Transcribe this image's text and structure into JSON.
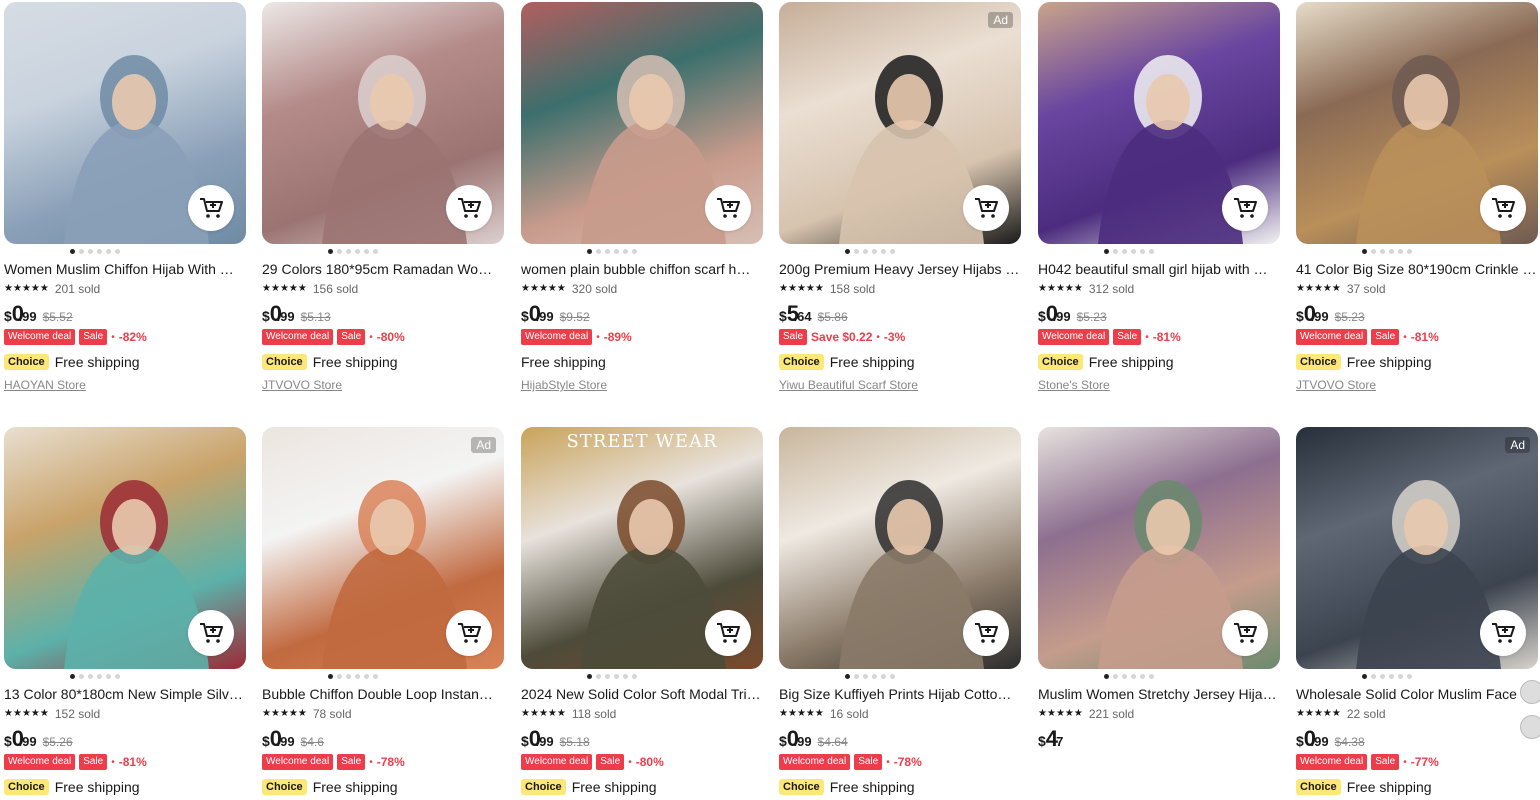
{
  "cards": [
    {
      "title": "Women Muslim Chiffon Hijab With …",
      "sold": "201 sold",
      "currency": "$",
      "price_int": "0",
      "price_dec": ".99",
      "old": "$5.52",
      "tags": [
        "Welcome deal",
        "Sale"
      ],
      "disc": "-82%",
      "choice": "Choice",
      "shipping": "Free shipping",
      "store": "HAOYAN Store",
      "ad": false,
      "colors": [
        "#8aa0b8",
        "#c9d3de",
        "#6f8ba4",
        "#d6dce3"
      ]
    },
    {
      "title": "29 Colors 180*95cm Ramadan Wo…",
      "sold": "156 sold",
      "currency": "$",
      "price_int": "0",
      "price_dec": ".99",
      "old": "$5.13",
      "tags": [
        "Welcome deal",
        "Sale"
      ],
      "disc": "-80%",
      "choice": "Choice",
      "shipping": "Free shipping",
      "store": "JTVOVO Store",
      "ad": false,
      "colors": [
        "#9b7472",
        "#b48b89",
        "#dcd0cf",
        "#ece8e6"
      ]
    },
    {
      "title": "women plain bubble chiffon scarf h…",
      "sold": "320 sold",
      "currency": "$",
      "price_int": "0",
      "price_dec": ".99",
      "old": "$9.52",
      "tags": [
        "Welcome deal"
      ],
      "disc": "-89%",
      "choice": "",
      "shipping": "Free shipping",
      "store": "HijabStyle Store",
      "ad": false,
      "colors": [
        "#c89b8c",
        "#3c6f6c",
        "#d7bfb4",
        "#b35e5f"
      ]
    },
    {
      "title": "200g Premium Heavy Jersey Hijabs …",
      "sold": "158 sold",
      "currency": "$",
      "price_int": "5",
      "price_dec": ".64",
      "old": "$5.86",
      "tags": [
        "Sale"
      ],
      "save": "Save $0.22",
      "disc": "-3%",
      "choice": "Choice",
      "shipping": "Free shipping",
      "store": "Yiwu Beautiful Scarf Store",
      "ad": true,
      "colors": [
        "#d7c3ae",
        "#eadfd3",
        "#1a1a1a",
        "#c6ae98"
      ]
    },
    {
      "title": "H042 beautiful small girl hijab with …",
      "sold": "312 sold",
      "currency": "$",
      "price_int": "0",
      "price_dec": ".99",
      "old": "$5.23",
      "tags": [
        "Welcome deal",
        "Sale"
      ],
      "disc": "-81%",
      "choice": "Choice",
      "shipping": "Free shipping",
      "store": "Stone's Store",
      "ad": false,
      "colors": [
        "#4b2c7e",
        "#6a46a0",
        "#f3f3f3",
        "#c9a48a"
      ]
    },
    {
      "title": "41 Color Big Size 80*190cm Crinkle …",
      "sold": "37 sold",
      "currency": "$",
      "price_int": "0",
      "price_dec": ".99",
      "old": "$5.23",
      "tags": [
        "Welcome deal",
        "Sale"
      ],
      "disc": "-81%",
      "choice": "Choice",
      "shipping": "Free shipping",
      "store": "JTVOVO Store",
      "ad": false,
      "colors": [
        "#b98f5a",
        "#8a6a55",
        "#6e5a52",
        "#e6dcc8"
      ]
    },
    {
      "title": "13 Color 80*180cm New Simple Silv…",
      "sold": "152 sold",
      "currency": "$",
      "price_int": "0",
      "price_dec": ".99",
      "old": "$5.26",
      "tags": [
        "Welcome deal",
        "Sale"
      ],
      "disc": "-81%",
      "choice": "Choice",
      "shipping": "Free shipping",
      "store": "",
      "ad": false,
      "colors": [
        "#5cb1aa",
        "#c9a36a",
        "#9b2a35",
        "#e8dfd0"
      ]
    },
    {
      "title": "Bubble Chiffon Double Loop Instan…",
      "sold": "78 sold",
      "currency": "$",
      "price_int": "0",
      "price_dec": ".99",
      "old": "$4.6",
      "tags": [
        "Welcome deal",
        "Sale"
      ],
      "disc": "-78%",
      "choice": "Choice",
      "shipping": "Free shipping",
      "store": "",
      "ad": true,
      "colors": [
        "#c1693f",
        "#f4f4f4",
        "#d98359",
        "#ece5df"
      ]
    },
    {
      "title": "2024 New Solid Color Soft Modal Tri…",
      "sold": "118 sold",
      "currency": "$",
      "price_int": "0",
      "price_dec": ".99",
      "old": "$5.18",
      "tags": [
        "Welcome deal",
        "Sale"
      ],
      "disc": "-80%",
      "choice": "Choice",
      "shipping": "Free shipping",
      "store": "",
      "ad": false,
      "colors": [
        "#4d4b3a",
        "#e8e2dc",
        "#7a4a2c",
        "#c9a35a"
      ],
      "banner": "STREET WEAR"
    },
    {
      "title": "Big Size Kuffiyeh Prints Hijab Cotto…",
      "sold": "16 sold",
      "currency": "$",
      "price_int": "0",
      "price_dec": ".99",
      "old": "$4.64",
      "tags": [
        "Welcome deal",
        "Sale"
      ],
      "disc": "-78%",
      "choice": "Choice",
      "shipping": "Free shipping",
      "store": "",
      "ad": false,
      "colors": [
        "#8a7a68",
        "#efe9e2",
        "#2d2d2d",
        "#c8b69c"
      ]
    },
    {
      "title": "Muslim Women Stretchy Jersey Hija…",
      "sold": "221 sold",
      "currency": "$",
      "price_int": "4",
      "price_dec": ".7",
      "old": "",
      "tags": [],
      "disc": "",
      "choice": "",
      "shipping": "",
      "store": "",
      "ad": false,
      "colors": [
        "#c59c8c",
        "#8d6f8f",
        "#6b8a6e",
        "#e7e3df"
      ]
    },
    {
      "title": "Wholesale Solid Color Muslim Face …",
      "sold": "22 sold",
      "currency": "$",
      "price_int": "0",
      "price_dec": ".99",
      "old": "$4.38",
      "tags": [
        "Welcome deal",
        "Sale"
      ],
      "disc": "-77%",
      "choice": "Choice",
      "shipping": "Free shipping",
      "store": "",
      "ad": true,
      "colors": [
        "#3c4450",
        "#5e6773",
        "#d7d2cb",
        "#27303a"
      ]
    }
  ],
  "ad_label": "Ad",
  "cart_icon": "add-to-cart-icon",
  "accent": "#ed3d4a"
}
